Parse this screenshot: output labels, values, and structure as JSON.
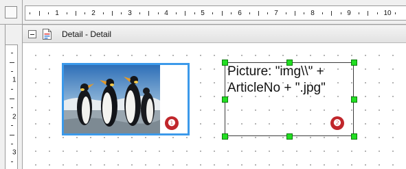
{
  "ruler": {
    "horizontal_numbers": [
      "1",
      "2",
      "3",
      "4",
      "5",
      "6",
      "7",
      "8",
      "9",
      "10"
    ],
    "vertical_numbers": [
      "1",
      "2",
      "3"
    ]
  },
  "section": {
    "title": "Detail - Detail",
    "toggle_icon": "collapse-minus-icon",
    "section_icon": "section-page-icon"
  },
  "image_object": {
    "icon": "penguins-image",
    "marker": "❶"
  },
  "text_object": {
    "text": "Picture: \"img\\\\\" +\nArticleNo + \".jpg\"",
    "marker": "❷"
  },
  "colors": {
    "selection_handle": "#22dd22",
    "image_frame": "#3b99ea",
    "marker": "#c0262b"
  }
}
